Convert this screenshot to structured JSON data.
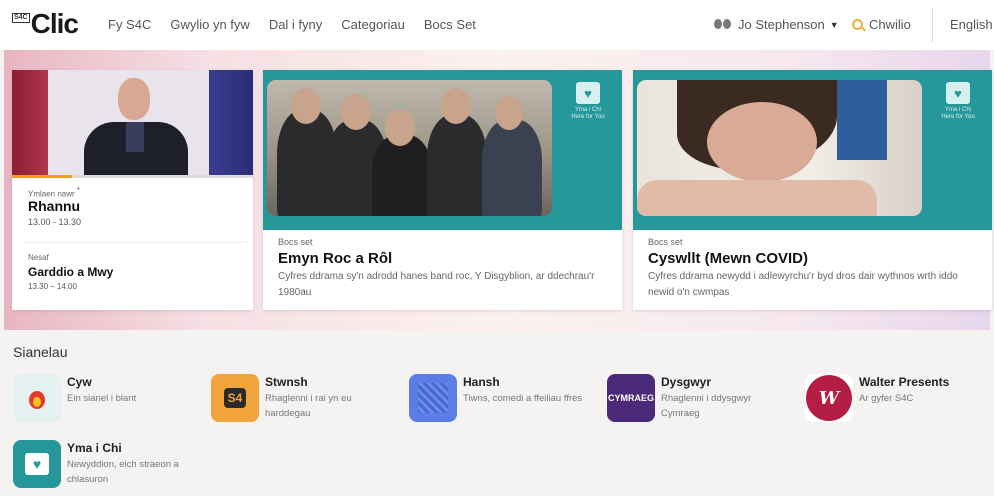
{
  "header": {
    "logo_small": "S4C",
    "logo": "Clic",
    "nav": [
      "Fy S4C",
      "Gwylio yn fyw",
      "Dal i fyny",
      "Categoriau",
      "Bocs Set"
    ],
    "user_name": "Jo Stephenson",
    "search_label": "Chwilio",
    "language": "English"
  },
  "live": {
    "now_label": "Ymlaen nawr",
    "now_marker": "*",
    "now_title": "Rhannu",
    "now_time": "13.00 - 13.30",
    "progress": 0.25,
    "next_label": "Nesaf",
    "next_title": "Garddio a Mwy",
    "next_time": "13.30 – 14.00"
  },
  "cards": [
    {
      "kicker": "Bocs set",
      "title": "Emyn Roc a Rôl",
      "description": "Cyfres ddrama sy'n adrodd hanes band roc, Y Disgyblion, ar ddechrau'r 1980au",
      "badge": "Yma i Chi\nHere for You"
    },
    {
      "kicker": "Bocs set",
      "title": "Cyswllt (Mewn COVID)",
      "description": "Cyfres ddrama newydd i adlewyrchu'r byd dros dair wythnos wrth iddo newid o'n cwmpas",
      "badge": "Yma i Chi\nHere for You"
    }
  ],
  "channels_title": "Sianelau",
  "channels": [
    {
      "name": "Cyw",
      "description": "Ein sianel i blant",
      "icon": "cyw-bird-icon"
    },
    {
      "name": "Stwnsh",
      "description": "Rhaglenni i rai yn eu harddegau",
      "icon": "stwnsh-icon",
      "icon_text": "S4"
    },
    {
      "name": "Hansh",
      "description": "Tiwns, comedi a ffeiliau ffres",
      "icon": "hansh-icon"
    },
    {
      "name": "Dysgwyr",
      "description": "Rhaglenni i ddysgwyr Cymraeg",
      "icon": "dysgwyr-icon",
      "icon_text": "CYMRAEG"
    },
    {
      "name": "Walter Presents",
      "description": "Ar gyfer S4C",
      "icon": "walter-presents-icon",
      "icon_text": "W"
    },
    {
      "name": "Yma i Chi",
      "description": "Newyddion, eich straeon a chlasuron",
      "icon": "yma-i-chi-icon"
    }
  ],
  "colors": {
    "teal": "#26979b",
    "search_accent": "#e9b23a",
    "live_progress": "#f0a020"
  }
}
